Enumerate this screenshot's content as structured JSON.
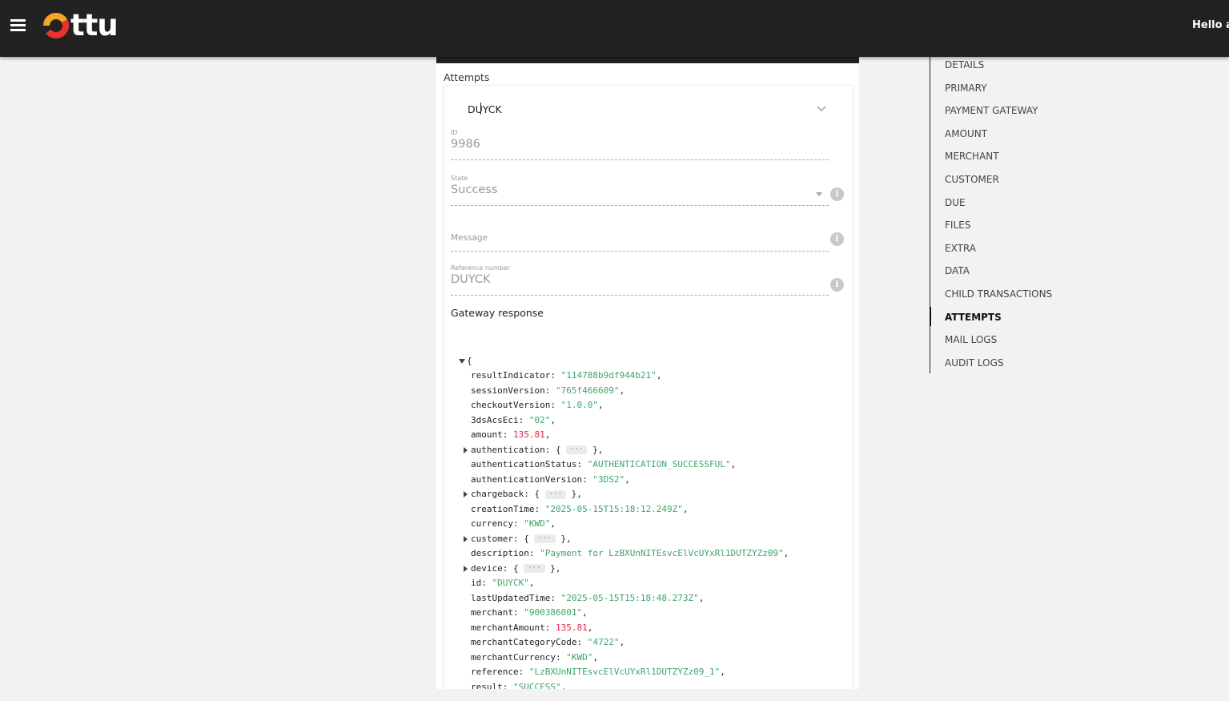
{
  "header": {
    "logo_text": "ttu",
    "greeting": "Hello al",
    "brand_colors": {
      "bar": "#222222",
      "logo_ring_orange": "#f5a623",
      "logo_ring_red": "#e8322f"
    }
  },
  "section": {
    "title": "Attempts"
  },
  "attempt_select": {
    "value": "DUYCK"
  },
  "fields": {
    "id": {
      "label": "ID",
      "value": "9986"
    },
    "state": {
      "label": "State",
      "value": "Success"
    },
    "message": {
      "label": "Message",
      "value": ""
    },
    "reference_number": {
      "label": "Reference number",
      "value": "DUYCK"
    }
  },
  "gateway_response": {
    "title": "Gateway response",
    "open_brace": "{",
    "rows": [
      {
        "key": "resultIndicator",
        "type": "string",
        "value": "\"114788b9df944b21\""
      },
      {
        "key": "sessionVersion",
        "type": "string",
        "value": "\"765f466609\""
      },
      {
        "key": "checkoutVersion",
        "type": "string",
        "value": "\"1.0.0\""
      },
      {
        "key": "3dsAcsEci",
        "type": "string",
        "value": "\"02\""
      },
      {
        "key": "amount",
        "type": "number",
        "value": "135.81"
      },
      {
        "key": "authentication",
        "type": "object",
        "value": "···"
      },
      {
        "key": "authenticationStatus",
        "type": "string",
        "value": "\"AUTHENTICATION_SUCCESSFUL\""
      },
      {
        "key": "authenticationVersion",
        "type": "string",
        "value": "\"3DS2\""
      },
      {
        "key": "chargeback",
        "type": "object",
        "value": "···"
      },
      {
        "key": "creationTime",
        "type": "string",
        "value": "\"2025-05-15T15:18:12.249Z\""
      },
      {
        "key": "currency",
        "type": "string",
        "value": "\"KWD\""
      },
      {
        "key": "customer",
        "type": "object",
        "value": "···"
      },
      {
        "key": "description",
        "type": "string",
        "value": "\"Payment for LzBXUnNITEsvcElVcUYxRl1DUTZYZz09\""
      },
      {
        "key": "device",
        "type": "object",
        "value": "···"
      },
      {
        "key": "id",
        "type": "string",
        "value": "\"DUYCK\""
      },
      {
        "key": "lastUpdatedTime",
        "type": "string",
        "value": "\"2025-05-15T15:18:48.273Z\""
      },
      {
        "key": "merchant",
        "type": "string",
        "value": "\"900386001\""
      },
      {
        "key": "merchantAmount",
        "type": "number",
        "value": "135.81"
      },
      {
        "key": "merchantCategoryCode",
        "type": "string",
        "value": "\"4722\""
      },
      {
        "key": "merchantCurrency",
        "type": "string",
        "value": "\"KWD\""
      },
      {
        "key": "reference",
        "type": "string",
        "value": "\"LzBXUnNITEsvcElVcUYxRl1DUTZYZz09_1\""
      },
      {
        "key": "result",
        "type": "string",
        "value": "\"SUCCESS\""
      }
    ]
  },
  "sidenav": {
    "active": "ATTEMPTS",
    "items": [
      "DETAILS",
      "PRIMARY",
      "PAYMENT GATEWAY",
      "AMOUNT",
      "MERCHANT",
      "CUSTOMER",
      "DUE",
      "FILES",
      "EXTRA",
      "DATA",
      "CHILD TRANSACTIONS",
      "ATTEMPTS",
      "MAIL LOGS",
      "AUDIT LOGS"
    ]
  }
}
